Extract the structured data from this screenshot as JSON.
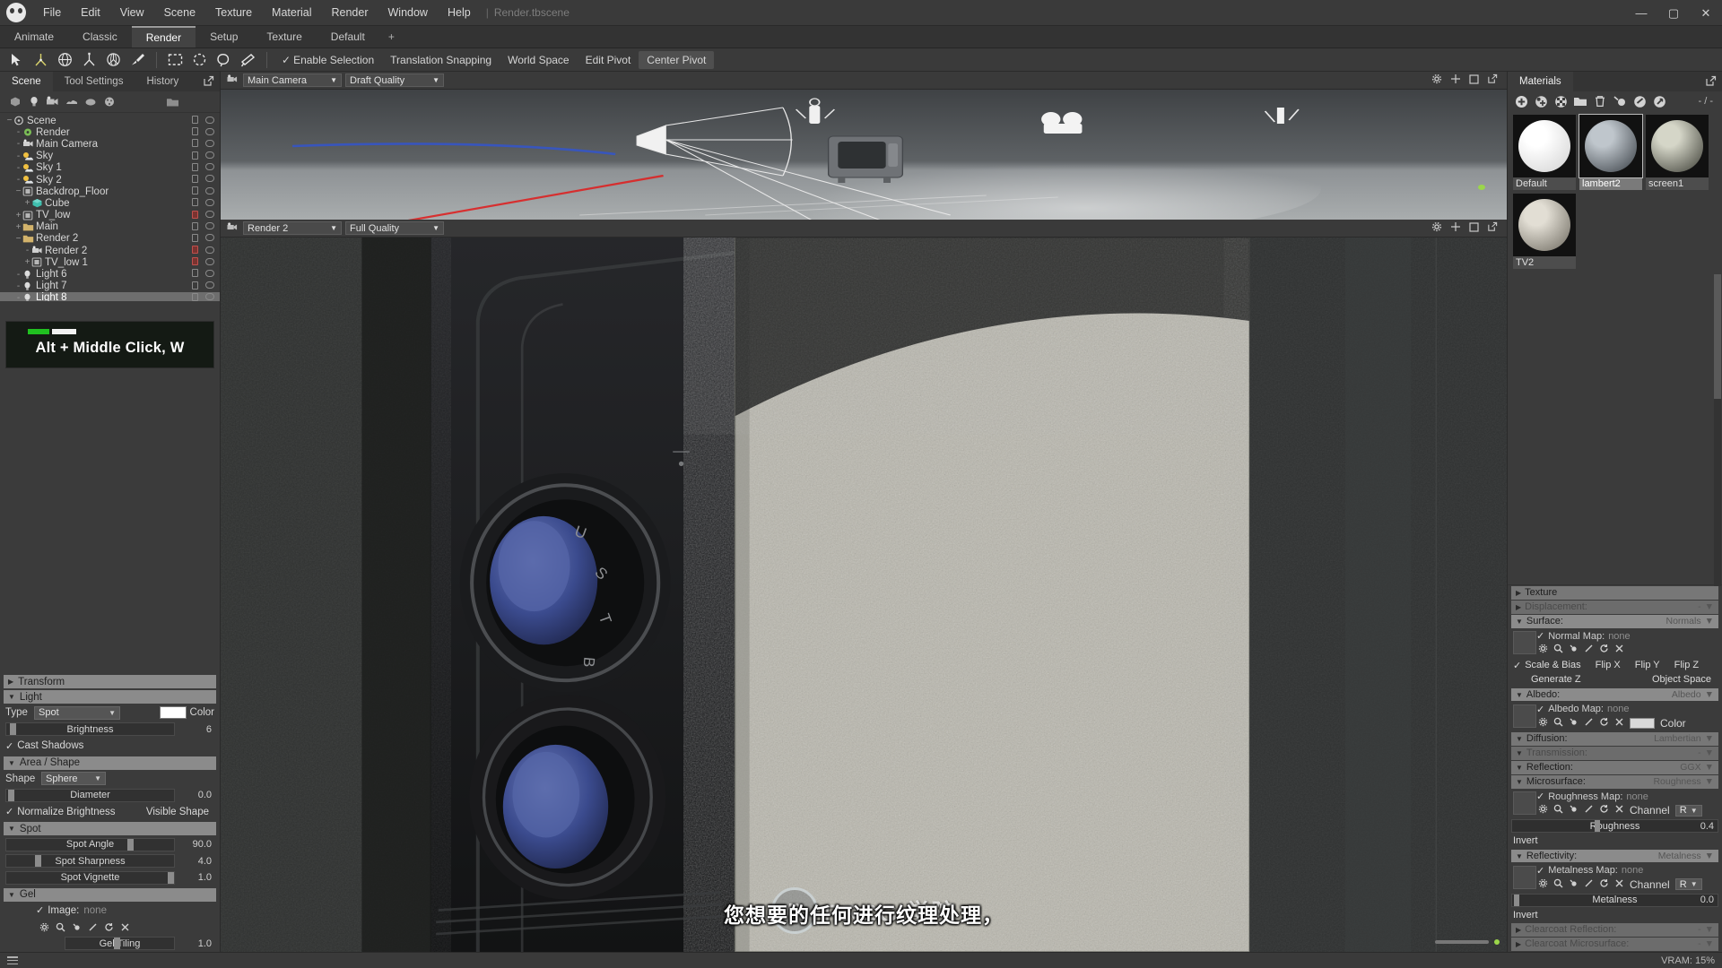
{
  "app": {
    "title": "Render.tbscene",
    "menu": [
      "File",
      "Edit",
      "View",
      "Scene",
      "Texture",
      "Material",
      "Render",
      "Window",
      "Help"
    ],
    "window_buttons": {
      "minimize": "—",
      "maximize": "▢",
      "close": "✕"
    }
  },
  "layout_tabs": [
    {
      "label": "Animate",
      "active": false
    },
    {
      "label": "Classic",
      "active": false
    },
    {
      "label": "Render",
      "active": true
    },
    {
      "label": "Setup",
      "active": false
    },
    {
      "label": "Texture",
      "active": false
    },
    {
      "label": "Default",
      "active": false
    },
    {
      "label": "+",
      "active": false
    }
  ],
  "toolbar": {
    "tools": [
      "select-arrow-icon",
      "move-gizmo-icon",
      "rotate-gizmo-icon",
      "scale-gizmo-icon",
      "transform-gizmo-icon",
      "paint-brush-icon",
      "rect-select-icon",
      "circle-select-icon",
      "lasso-select-icon",
      "poly-select-icon"
    ],
    "options": [
      {
        "label": "Enable Selection",
        "checked": true,
        "active": false
      },
      {
        "label": "Translation Snapping",
        "checked": false,
        "active": false
      },
      {
        "label": "World Space",
        "checked": false,
        "active": false
      },
      {
        "label": "Edit Pivot",
        "checked": false,
        "active": false
      },
      {
        "label": "Center Pivot",
        "checked": false,
        "active": true
      }
    ]
  },
  "left_panel": {
    "tabs": [
      {
        "label": "Scene",
        "active": true
      },
      {
        "label": "Tool Settings",
        "active": false
      },
      {
        "label": "History",
        "active": false
      }
    ],
    "outliner_tools": [
      "add-mesh-icon",
      "add-light-icon",
      "add-camera-icon",
      "add-sky-icon",
      "add-fog-icon",
      "add-material-icon",
      "folder-icon"
    ],
    "tree": [
      {
        "label": "Scene",
        "depth": 0,
        "icon": "scene-icon",
        "expander": "−",
        "selected": false,
        "lock": false,
        "eye": true
      },
      {
        "label": "Render",
        "depth": 1,
        "icon": "render-icon",
        "expander": "-",
        "selected": false,
        "lock": false,
        "eye": true
      },
      {
        "label": "Main Camera",
        "depth": 1,
        "icon": "camera-icon",
        "expander": "-",
        "selected": false,
        "lock": false,
        "eye": true
      },
      {
        "label": "Sky",
        "depth": 1,
        "icon": "sky-icon",
        "expander": "-",
        "selected": false,
        "lock": false,
        "eye": true
      },
      {
        "label": "Sky 1",
        "depth": 1,
        "icon": "sky-icon",
        "expander": "-",
        "selected": false,
        "lock": false,
        "eye": true
      },
      {
        "label": "Sky 2",
        "depth": 1,
        "icon": "sky-icon",
        "expander": "-",
        "selected": false,
        "lock": false,
        "eye": true
      },
      {
        "label": "Backdrop_Floor",
        "depth": 1,
        "icon": "mesh-icon",
        "expander": "−",
        "selected": false,
        "lock": false,
        "eye": true
      },
      {
        "label": "Cube",
        "depth": 2,
        "icon": "cube-icon",
        "expander": "+",
        "selected": false,
        "lock": false,
        "eye": true
      },
      {
        "label": "TV_low",
        "depth": 1,
        "icon": "mesh-icon",
        "expander": "+",
        "selected": false,
        "lock": true,
        "eye": true
      },
      {
        "label": "Main",
        "depth": 1,
        "icon": "folder-icon",
        "expander": "+",
        "selected": false,
        "lock": false,
        "eye": true
      },
      {
        "label": "Render 2",
        "depth": 1,
        "icon": "folder-icon",
        "expander": "−",
        "selected": false,
        "lock": false,
        "eye": true
      },
      {
        "label": "Render 2",
        "depth": 2,
        "icon": "camera-icon",
        "expander": "-",
        "selected": false,
        "lock": true,
        "eye": true
      },
      {
        "label": "TV_low 1",
        "depth": 2,
        "icon": "mesh-icon",
        "expander": "+",
        "selected": false,
        "lock": true,
        "eye": true
      },
      {
        "label": "Light 6",
        "depth": 1,
        "icon": "light-icon",
        "expander": "-",
        "selected": false,
        "lock": false,
        "eye": true
      },
      {
        "label": "Light 7",
        "depth": 1,
        "icon": "light-icon",
        "expander": "-",
        "selected": false,
        "lock": false,
        "eye": true
      },
      {
        "label": "Light 8",
        "depth": 1,
        "icon": "light-icon",
        "expander": "-",
        "selected": true,
        "lock": false,
        "eye": true
      }
    ],
    "tip_overlay": {
      "text": "Alt + Middle Click, W",
      "bars": [
        "#20c020",
        "#f2f2f2"
      ]
    },
    "properties": {
      "transform": {
        "label": "Transform",
        "expanded": false
      },
      "light": {
        "label": "Light",
        "expanded": true,
        "type_label": "Type",
        "type_value": "Spot",
        "color_label": "Color",
        "color_value": "#ffffff",
        "brightness_label": "Brightness",
        "brightness_value": "6",
        "brightness_fill": 0.03,
        "cast_shadows_label": "Cast Shadows",
        "cast_shadows": true
      },
      "area_shape": {
        "label": "Area / Shape",
        "expanded": true,
        "shape_label": "Shape",
        "shape_value": "Sphere",
        "diameter_label": "Diameter",
        "diameter_value": "0.0",
        "diameter_fill": 0.02,
        "normalize_label": "Normalize Brightness",
        "normalize": true,
        "visible_shape_label": "Visible Shape",
        "visible_shape": false
      },
      "spot": {
        "label": "Spot",
        "expanded": true,
        "rows": [
          {
            "label": "Spot Angle",
            "value": "90.0",
            "knob": 0.72
          },
          {
            "label": "Spot Sharpness",
            "value": "4.0",
            "knob": 0.17
          },
          {
            "label": "Spot Vignette",
            "value": "1.0",
            "knob": 0.97
          }
        ]
      },
      "gel": {
        "label": "Gel",
        "expanded": true,
        "image_label": "Image:",
        "image_value": "none",
        "image_checked": true,
        "tiling_label": "Gel Tiling",
        "tiling_value": "1.0",
        "tiling_knob": 0.45
      }
    }
  },
  "viewports": {
    "top": {
      "camera": "Main Camera",
      "quality": "Draft Quality",
      "icons": [
        "gear-icon",
        "move-icon",
        "maximize-icon",
        "popout-icon"
      ]
    },
    "main": {
      "camera": "Render 2",
      "quality": "Full Quality",
      "icons": [
        "gear-icon",
        "move-icon",
        "maximize-icon",
        "popout-icon"
      ]
    },
    "subtitle": "您想要的任何进行纹理处理，",
    "watermark": {
      "mark": "R",
      "text": "RRCG 学院"
    }
  },
  "right_panel": {
    "tab": "Materials",
    "tools": [
      "add-material-icon",
      "duplicate-material-icon",
      "clear-material-icon",
      "folder-icon",
      "trash-icon",
      "pick-material-icon",
      "assign-material-icon",
      "refresh-material-icon"
    ],
    "counter": "- / -",
    "materials": [
      {
        "name": "Default",
        "selected": false,
        "ball": "#ffffff",
        "ball2": "#d8d8d8"
      },
      {
        "name": "lambert2",
        "selected": true,
        "ball": "#bfc6cc",
        "ball2": "#4c5258"
      },
      {
        "name": "screen1",
        "selected": false,
        "ball": "#d5d6c8",
        "ball2": "#52534a"
      },
      {
        "name": "TV2",
        "selected": false,
        "ball": "#e2ded4",
        "ball2": "#7e7a70"
      }
    ],
    "sections": [
      {
        "name": "Texture",
        "kind": "header",
        "expanded": false,
        "value": "",
        "dim": false
      },
      {
        "name": "Displacement:",
        "kind": "header",
        "expanded": false,
        "value": "-",
        "dim": true
      },
      {
        "name": "Surface:",
        "kind": "header",
        "expanded": true,
        "value": "Normals",
        "dim": false
      },
      {
        "name": "Albedo:",
        "kind": "header",
        "expanded": true,
        "value": "Albedo",
        "dim": false
      },
      {
        "name": "Diffusion:",
        "kind": "header",
        "expanded": true,
        "value": "Lambertian",
        "dim": true
      },
      {
        "name": "Transmission:",
        "kind": "header",
        "expanded": true,
        "value": "-",
        "dim": true
      },
      {
        "name": "Reflection:",
        "kind": "header",
        "expanded": true,
        "value": "GGX",
        "dim": false
      },
      {
        "name": "Microsurface:",
        "kind": "header",
        "expanded": true,
        "value": "Roughness",
        "dim": false
      },
      {
        "name": "Reflectivity:",
        "kind": "header",
        "expanded": true,
        "value": "Metalness",
        "dim": false
      },
      {
        "name": "Clearcoat Reflection:",
        "kind": "header",
        "expanded": false,
        "value": "-",
        "dim": true
      },
      {
        "name": "Clearcoat Microsurface:",
        "kind": "header",
        "expanded": false,
        "value": "-",
        "dim": true
      }
    ],
    "surface": {
      "map_label": "Normal Map:",
      "map_value": "none",
      "map_checked": true,
      "scale_bias_label": "Scale & Bias",
      "scale_bias_checked": true,
      "flip_x": "Flip X",
      "flip_y": "Flip Y",
      "flip_z": "Flip Z",
      "generate_z": "Generate Z",
      "object_space": "Object Space"
    },
    "albedo": {
      "map_label": "Albedo Map:",
      "map_value": "none",
      "map_checked": true,
      "color_label": "Color",
      "color_value": "#d8d8d8"
    },
    "microsurface": {
      "map_label": "Roughness Map:",
      "map_value": "none",
      "map_checked": true,
      "channel_label": "Channel",
      "channel_value": "R",
      "slider_label": "Roughness",
      "slider_value": "0.4",
      "slider_knob": 0.4,
      "invert_label": "Invert"
    },
    "reflectivity": {
      "map_label": "Metalness Map:",
      "map_value": "none",
      "map_checked": true,
      "channel_label": "Channel",
      "channel_value": "R",
      "slider_label": "Metalness",
      "slider_value": "0.0",
      "slider_knob": 0.01,
      "invert_label": "Invert"
    }
  },
  "status": {
    "vram": "VRAM: 15%"
  }
}
